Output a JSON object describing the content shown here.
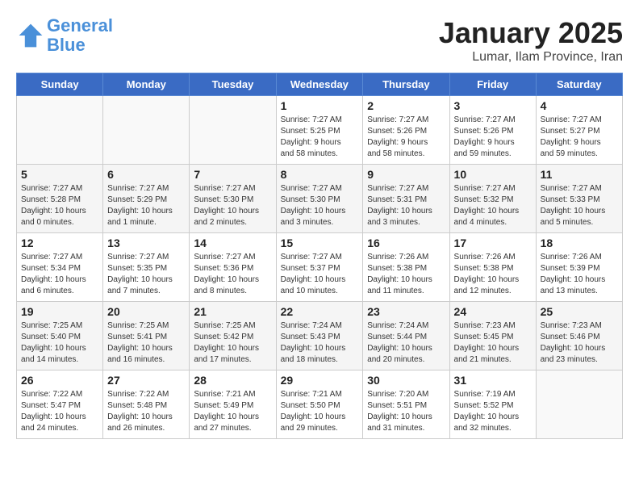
{
  "header": {
    "logo_line1": "General",
    "logo_line2": "Blue",
    "title": "January 2025",
    "subtitle": "Lumar, Ilam Province, Iran"
  },
  "weekdays": [
    "Sunday",
    "Monday",
    "Tuesday",
    "Wednesday",
    "Thursday",
    "Friday",
    "Saturday"
  ],
  "weeks": [
    [
      {
        "day": "",
        "info": ""
      },
      {
        "day": "",
        "info": ""
      },
      {
        "day": "",
        "info": ""
      },
      {
        "day": "1",
        "info": "Sunrise: 7:27 AM\nSunset: 5:25 PM\nDaylight: 9 hours\nand 58 minutes."
      },
      {
        "day": "2",
        "info": "Sunrise: 7:27 AM\nSunset: 5:26 PM\nDaylight: 9 hours\nand 58 minutes."
      },
      {
        "day": "3",
        "info": "Sunrise: 7:27 AM\nSunset: 5:26 PM\nDaylight: 9 hours\nand 59 minutes."
      },
      {
        "day": "4",
        "info": "Sunrise: 7:27 AM\nSunset: 5:27 PM\nDaylight: 9 hours\nand 59 minutes."
      }
    ],
    [
      {
        "day": "5",
        "info": "Sunrise: 7:27 AM\nSunset: 5:28 PM\nDaylight: 10 hours\nand 0 minutes."
      },
      {
        "day": "6",
        "info": "Sunrise: 7:27 AM\nSunset: 5:29 PM\nDaylight: 10 hours\nand 1 minute."
      },
      {
        "day": "7",
        "info": "Sunrise: 7:27 AM\nSunset: 5:30 PM\nDaylight: 10 hours\nand 2 minutes."
      },
      {
        "day": "8",
        "info": "Sunrise: 7:27 AM\nSunset: 5:30 PM\nDaylight: 10 hours\nand 3 minutes."
      },
      {
        "day": "9",
        "info": "Sunrise: 7:27 AM\nSunset: 5:31 PM\nDaylight: 10 hours\nand 3 minutes."
      },
      {
        "day": "10",
        "info": "Sunrise: 7:27 AM\nSunset: 5:32 PM\nDaylight: 10 hours\nand 4 minutes."
      },
      {
        "day": "11",
        "info": "Sunrise: 7:27 AM\nSunset: 5:33 PM\nDaylight: 10 hours\nand 5 minutes."
      }
    ],
    [
      {
        "day": "12",
        "info": "Sunrise: 7:27 AM\nSunset: 5:34 PM\nDaylight: 10 hours\nand 6 minutes."
      },
      {
        "day": "13",
        "info": "Sunrise: 7:27 AM\nSunset: 5:35 PM\nDaylight: 10 hours\nand 7 minutes."
      },
      {
        "day": "14",
        "info": "Sunrise: 7:27 AM\nSunset: 5:36 PM\nDaylight: 10 hours\nand 8 minutes."
      },
      {
        "day": "15",
        "info": "Sunrise: 7:27 AM\nSunset: 5:37 PM\nDaylight: 10 hours\nand 10 minutes."
      },
      {
        "day": "16",
        "info": "Sunrise: 7:26 AM\nSunset: 5:38 PM\nDaylight: 10 hours\nand 11 minutes."
      },
      {
        "day": "17",
        "info": "Sunrise: 7:26 AM\nSunset: 5:38 PM\nDaylight: 10 hours\nand 12 minutes."
      },
      {
        "day": "18",
        "info": "Sunrise: 7:26 AM\nSunset: 5:39 PM\nDaylight: 10 hours\nand 13 minutes."
      }
    ],
    [
      {
        "day": "19",
        "info": "Sunrise: 7:25 AM\nSunset: 5:40 PM\nDaylight: 10 hours\nand 14 minutes."
      },
      {
        "day": "20",
        "info": "Sunrise: 7:25 AM\nSunset: 5:41 PM\nDaylight: 10 hours\nand 16 minutes."
      },
      {
        "day": "21",
        "info": "Sunrise: 7:25 AM\nSunset: 5:42 PM\nDaylight: 10 hours\nand 17 minutes."
      },
      {
        "day": "22",
        "info": "Sunrise: 7:24 AM\nSunset: 5:43 PM\nDaylight: 10 hours\nand 18 minutes."
      },
      {
        "day": "23",
        "info": "Sunrise: 7:24 AM\nSunset: 5:44 PM\nDaylight: 10 hours\nand 20 minutes."
      },
      {
        "day": "24",
        "info": "Sunrise: 7:23 AM\nSunset: 5:45 PM\nDaylight: 10 hours\nand 21 minutes."
      },
      {
        "day": "25",
        "info": "Sunrise: 7:23 AM\nSunset: 5:46 PM\nDaylight: 10 hours\nand 23 minutes."
      }
    ],
    [
      {
        "day": "26",
        "info": "Sunrise: 7:22 AM\nSunset: 5:47 PM\nDaylight: 10 hours\nand 24 minutes."
      },
      {
        "day": "27",
        "info": "Sunrise: 7:22 AM\nSunset: 5:48 PM\nDaylight: 10 hours\nand 26 minutes."
      },
      {
        "day": "28",
        "info": "Sunrise: 7:21 AM\nSunset: 5:49 PM\nDaylight: 10 hours\nand 27 minutes."
      },
      {
        "day": "29",
        "info": "Sunrise: 7:21 AM\nSunset: 5:50 PM\nDaylight: 10 hours\nand 29 minutes."
      },
      {
        "day": "30",
        "info": "Sunrise: 7:20 AM\nSunset: 5:51 PM\nDaylight: 10 hours\nand 31 minutes."
      },
      {
        "day": "31",
        "info": "Sunrise: 7:19 AM\nSunset: 5:52 PM\nDaylight: 10 hours\nand 32 minutes."
      },
      {
        "day": "",
        "info": ""
      }
    ]
  ]
}
